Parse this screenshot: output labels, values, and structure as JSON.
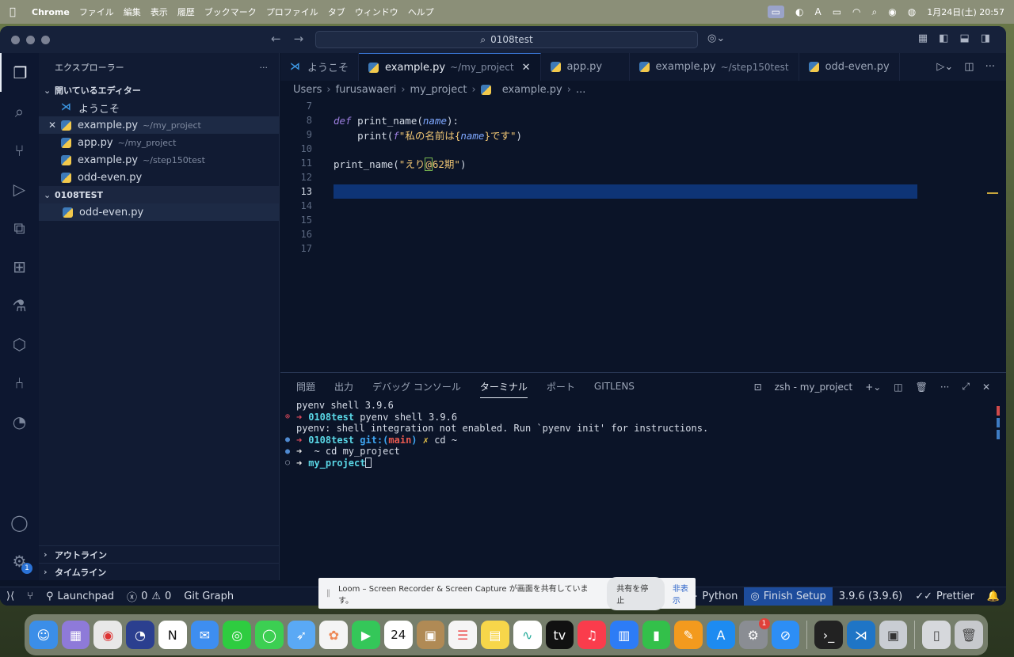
{
  "menubar": {
    "items": [
      "Chrome",
      "ファイル",
      "編集",
      "表示",
      "履歴",
      "ブックマーク",
      "プロファイル",
      "タブ",
      "ウィンドウ",
      "ヘルプ"
    ],
    "clock": "1月24日(土)  20:57",
    "input_mode": "A"
  },
  "window": {
    "search_text": "0108test"
  },
  "sidebar": {
    "title": "エクスプローラー",
    "more": "···",
    "open_editors_title": "開いているエディター",
    "open_editors": [
      {
        "name": "ようこそ",
        "path": "",
        "icon": "vscode-icon"
      },
      {
        "name": "example.py",
        "path": "~/my_project",
        "icon": "python-icon"
      },
      {
        "name": "app.py",
        "path": "~/my_project",
        "icon": "python-icon"
      },
      {
        "name": "example.py",
        "path": "~/step150test",
        "icon": "python-icon"
      },
      {
        "name": "odd-even.py",
        "path": "",
        "icon": "python-icon"
      }
    ],
    "folder_title": "0108TEST",
    "folder_files": [
      {
        "name": "odd-even.py"
      }
    ],
    "outline_title": "アウトライン",
    "timeline_title": "タイムライン"
  },
  "tabs": [
    {
      "label": "ようこそ",
      "path": ""
    },
    {
      "label": "example.py",
      "path": "~/my_project",
      "close": "✕"
    },
    {
      "label": "app.py",
      "path": ""
    },
    {
      "label": "example.py",
      "path": "~/step150test"
    },
    {
      "label": "odd-even.py",
      "path": ""
    }
  ],
  "breadcrumb": [
    "Users",
    "furusawaeri",
    "my_project",
    "example.py",
    "..."
  ],
  "editor": {
    "line_numbers": [
      "7",
      "8",
      "9",
      "10",
      "11",
      "12",
      "13",
      "14",
      "15",
      "16",
      "17"
    ],
    "current_line": "13",
    "code": {
      "l8_kw": "def",
      "l8_fn": " print_name(",
      "l8_param": "name",
      "l8_end": "):",
      "l9_indent": "    print(",
      "l9_f": "f",
      "l9_str1": "\"私の名前は{",
      "l9_param": "name",
      "l9_str2": "}です\"",
      "l9_end": ")",
      "l11_fn": "print_name(",
      "l11_str1": "\"えり",
      "l11_at": "@",
      "l11_str2": "62期\"",
      "l11_end": ")"
    }
  },
  "panel": {
    "tabs": [
      "問題",
      "出力",
      "デバッグ コンソール",
      "ターミナル",
      "ポート",
      "GITLENS"
    ],
    "active_tab": "ターミナル",
    "terminal_name": "zsh - my_project",
    "terminal": {
      "l1": "pyenv shell 3.9.6",
      "l2_arrow": "➜",
      "l2_dir": "0108test",
      "l2_cmd": " pyenv shell 3.9.6",
      "l3": "pyenv: shell integration not enabled. Run `pyenv init' for instructions.",
      "l4_arrow": "➜",
      "l4_dir": "0108test",
      "l4_git": " git:(",
      "l4_branch": "main",
      "l4_close": ")",
      "l4_x": " ✗",
      "l4_cmd": " cd ~",
      "l5_arrow": "➜",
      "l5_cmd": " ~ cd my_project",
      "l6_arrow": "➜",
      "l6_dir": "my_project"
    }
  },
  "statusbar": {
    "launchpad": "Launchpad",
    "errors": "0",
    "warnings": "0",
    "git_graph": "Git Graph",
    "language": "Python",
    "finish_setup": "Finish Setup",
    "python_version": "3.9.6 (3.9.6)",
    "prettier": "Prettier"
  },
  "loom": {
    "message": "Loom – Screen Recorder & Screen Capture が画面を共有しています。",
    "stop": "共有を停止",
    "hide": "非表示"
  },
  "dock": {
    "calendar_day": "24",
    "settings_badge": "1"
  },
  "activity": {
    "settings_badge": "1"
  }
}
